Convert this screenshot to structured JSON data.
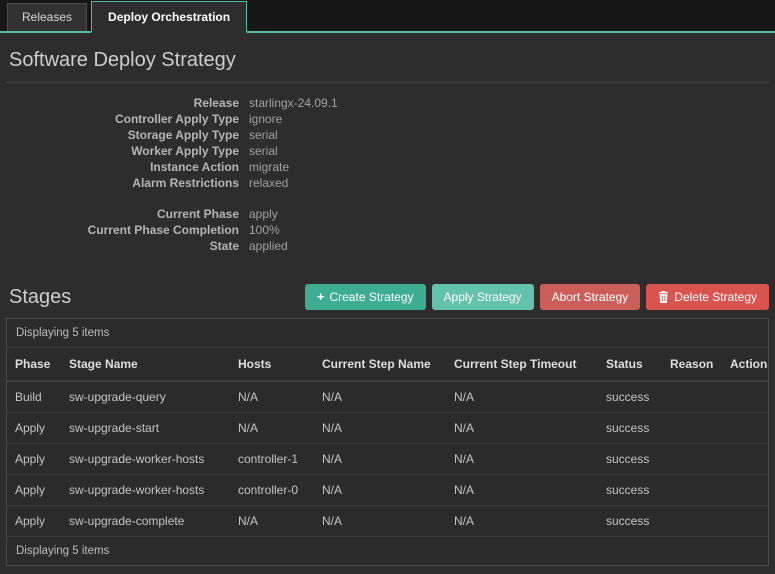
{
  "tabs": [
    {
      "label": "Releases",
      "active": false
    },
    {
      "label": "Deploy Orchestration",
      "active": true
    }
  ],
  "page": {
    "title": "Software Deploy Strategy"
  },
  "details": {
    "rows": [
      {
        "label": "Release",
        "value": "starlingx-24.09.1"
      },
      {
        "label": "Controller Apply Type",
        "value": "ignore"
      },
      {
        "label": "Storage Apply Type",
        "value": "serial"
      },
      {
        "label": "Worker Apply Type",
        "value": "serial"
      },
      {
        "label": "Instance Action",
        "value": "migrate"
      },
      {
        "label": "Alarm Restrictions",
        "value": "relaxed"
      }
    ],
    "status_rows": [
      {
        "label": "Current Phase",
        "value": "apply"
      },
      {
        "label": "Current Phase Completion",
        "value": "100%"
      },
      {
        "label": "State",
        "value": "applied"
      }
    ]
  },
  "stages": {
    "title": "Stages",
    "buttons": [
      {
        "label": "Create Strategy",
        "icon": "plus-icon"
      },
      {
        "label": "Apply Strategy"
      },
      {
        "label": "Abort Strategy"
      },
      {
        "label": "Delete Strategy",
        "icon": "trash-icon"
      }
    ],
    "table": {
      "summary_top": "Displaying 5 items",
      "summary_bottom": "Displaying 5 items",
      "columns": [
        "Phase",
        "Stage Name",
        "Hosts",
        "Current Step Name",
        "Current Step Timeout",
        "Status",
        "Reason",
        "Actions"
      ],
      "rows": [
        [
          "Build",
          "sw-upgrade-query",
          "N/A",
          "N/A",
          "N/A",
          "success",
          "",
          ""
        ],
        [
          "Apply",
          "sw-upgrade-start",
          "N/A",
          "N/A",
          "N/A",
          "success",
          "",
          ""
        ],
        [
          "Apply",
          "sw-upgrade-worker-hosts",
          "controller-1",
          "N/A",
          "N/A",
          "success",
          "",
          ""
        ],
        [
          "Apply",
          "sw-upgrade-worker-hosts",
          "controller-0",
          "N/A",
          "N/A",
          "success",
          "",
          ""
        ],
        [
          "Apply",
          "sw-upgrade-complete",
          "N/A",
          "N/A",
          "N/A",
          "success",
          "",
          ""
        ]
      ]
    }
  },
  "icons": {
    "plus_glyph": "+"
  },
  "colors": {
    "accent_teal": "#53bda5",
    "button_create": "#3dad92",
    "button_apply": "#64c1ab",
    "button_abort": "#cc5e5a",
    "button_delete": "#d9534f",
    "background": "#2d2d2d"
  }
}
